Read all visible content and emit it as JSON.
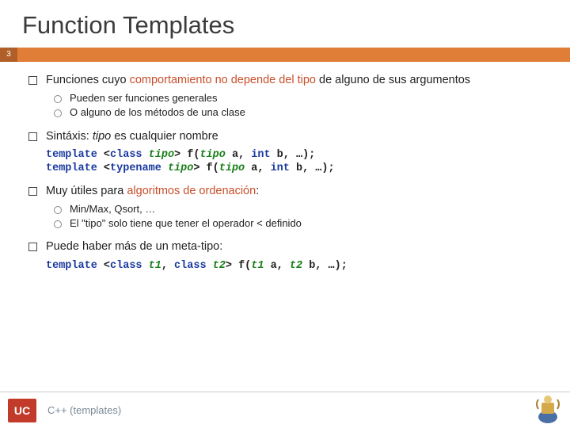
{
  "slide": {
    "title": "Function Templates",
    "number": "3"
  },
  "bullets": {
    "b1_text_a": "Funciones cuyo ",
    "b1_hl": "comportamiento no depende del tipo",
    "b1_text_b": " de alguno de sus argumentos",
    "b1_sub1": "Pueden ser funciones generales",
    "b1_sub2": "O alguno de los métodos de una clase",
    "b2_text_a": "Sintáxis: ",
    "b2_italic": "tipo",
    "b2_text_b": " es cualquier nombre",
    "b3_text_a": "Muy útiles para ",
    "b3_hl": "algoritmos de ordenación",
    "b3_text_b": ":",
    "b3_sub1": "Min/Max, Qsort, …",
    "b3_sub2": "El \"tipo\" solo tiene que tener el operador < definido",
    "b4_text": "Puede haber más de un meta-tipo:"
  },
  "code": {
    "l1_kw1": "template",
    "l1_a": " <",
    "l1_kw2": "class",
    "l1_sp": " ",
    "l1_tp": "tipo",
    "l1_b": "> f(",
    "l1_c": " a, ",
    "l1_kw3": "int",
    "l1_d": " b, …);",
    "l2_kw1": "template",
    "l2_a": " <",
    "l2_kw2": "typename",
    "l2_tp": "tipo",
    "l2_b": "> f(",
    "l2_c": " a, ",
    "l2_kw3": "int",
    "l2_d": " b, …);",
    "l3_kw1": "template",
    "l3_a": " <",
    "l3_kw2": "class",
    "l3_tp1": "t1",
    "l3_b": ", ",
    "l3_kw3": "class",
    "l3_tp2": "t2",
    "l3_c": "> f(",
    "l3_d": " a, ",
    "l3_e": " b, …);"
  },
  "footer": {
    "left_logo": "UC",
    "text": "C++ (templates)"
  }
}
